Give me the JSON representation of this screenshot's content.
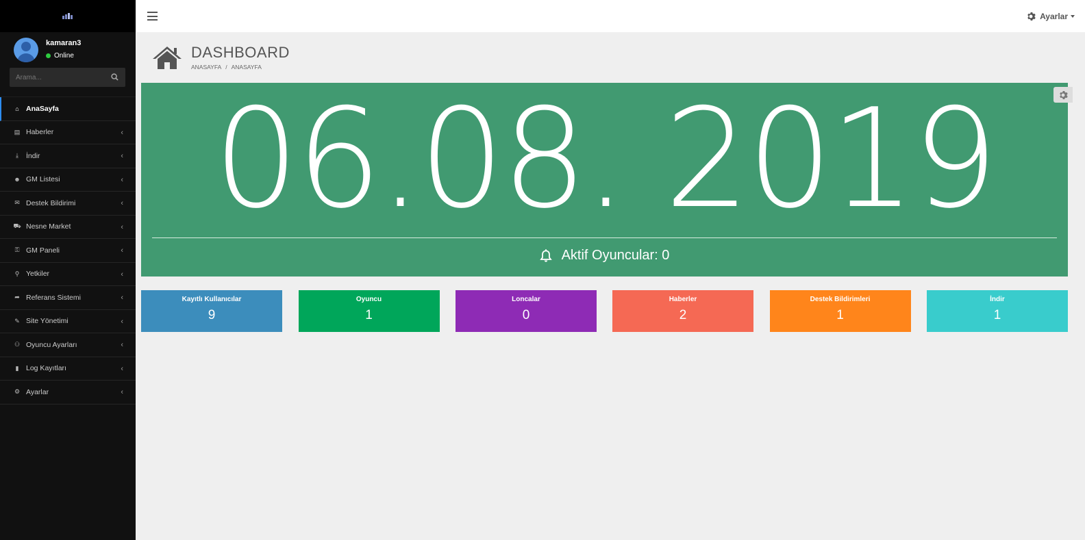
{
  "sidebar": {
    "user": {
      "name": "kamaran3",
      "status": "Online"
    },
    "search_placeholder": "Arama...",
    "items": [
      {
        "label": "AnaSayfa",
        "icon": "home-icon",
        "active": true
      },
      {
        "label": "Haberler",
        "icon": "newspaper-icon"
      },
      {
        "label": "İndir",
        "icon": "download-icon"
      },
      {
        "label": "GM Listesi",
        "icon": "users-icon"
      },
      {
        "label": "Destek Bildirimi",
        "icon": "envelope-icon"
      },
      {
        "label": "Nesne Market",
        "icon": "cart-icon"
      },
      {
        "label": "GM Paneli",
        "icon": "key-icon"
      },
      {
        "label": "Yetkiler",
        "icon": "pin-icon"
      },
      {
        "label": "Referans Sistemi",
        "icon": "share-icon"
      },
      {
        "label": "Site Yönetimi",
        "icon": "pencil-icon"
      },
      {
        "label": "Oyuncu Ayarları",
        "icon": "gamepad-icon"
      },
      {
        "label": "Log Kayıtları",
        "icon": "book-icon"
      },
      {
        "label": "Ayarlar",
        "icon": "gear-icon"
      }
    ]
  },
  "topbar": {
    "settings_label": "Ayarlar"
  },
  "page": {
    "title": "DASHBOARD",
    "breadcrumb": [
      "ANASAYFA",
      "ANASAYFA"
    ]
  },
  "hero": {
    "date": "06.08. 2019",
    "active_players": "Aktif Oyuncular: 0",
    "color": "#419a71"
  },
  "stats": [
    {
      "label": "Kayıtlı Kullanıcılar",
      "value": "9",
      "color": "#3c8dbc"
    },
    {
      "label": "Oyuncu",
      "value": "1",
      "color": "#00a65a"
    },
    {
      "label": "Loncalar",
      "value": "0",
      "color": "#8e2bb5"
    },
    {
      "label": "Haberler",
      "value": "2",
      "color": "#f56954"
    },
    {
      "label": "Destek Bildirimleri",
      "value": "1",
      "color": "#ff851b"
    },
    {
      "label": "İndir",
      "value": "1",
      "color": "#39cccc"
    }
  ]
}
